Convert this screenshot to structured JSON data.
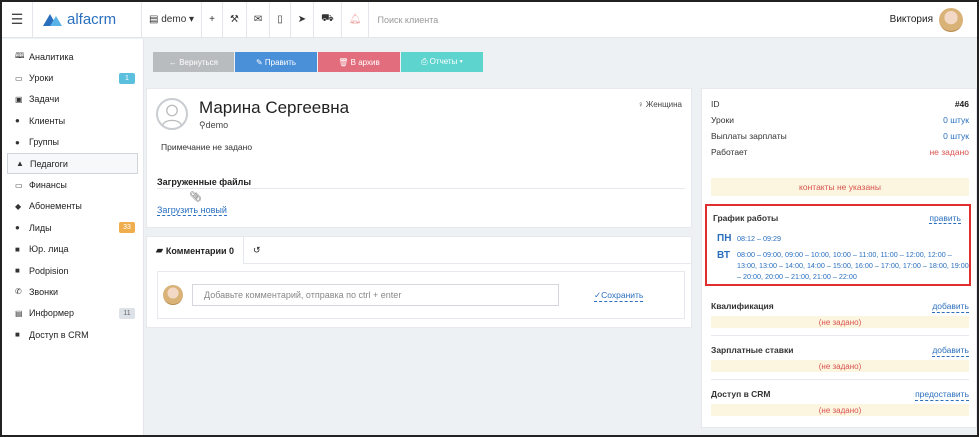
{
  "topbar": {
    "brand": "alfacrm",
    "branch": "demo",
    "search_placeholder": "Поиск клиента",
    "user_name": "Виктория",
    "icons": [
      "menu-icon",
      "branch-icon",
      "plus-icon",
      "wrench-icon",
      "mail-icon",
      "phone-icon",
      "telegram-icon",
      "cart-icon",
      "bell-icon"
    ]
  },
  "sidebar": {
    "items": [
      {
        "label": "Аналитика",
        "icon": "book-icon",
        "glyph": "🕮",
        "badge": null
      },
      {
        "label": "Уроки",
        "icon": "calendar-icon",
        "glyph": "▭",
        "badge": "1",
        "badge_color": "#5bc0de"
      },
      {
        "label": "Задачи",
        "icon": "clipboard-icon",
        "glyph": "▣",
        "badge": null
      },
      {
        "label": "Клиенты",
        "icon": "user-icon",
        "glyph": "●",
        "badge": null
      },
      {
        "label": "Группы",
        "icon": "users-icon",
        "glyph": "●",
        "badge": null
      },
      {
        "label": "Педагоги",
        "icon": "graduation-cap-icon",
        "glyph": "▲",
        "badge": null,
        "active": true
      },
      {
        "label": "Финансы",
        "icon": "money-icon",
        "glyph": "▭",
        "badge": null
      },
      {
        "label": "Абонементы",
        "icon": "tags-icon",
        "glyph": "◆",
        "badge": null
      },
      {
        "label": "Лиды",
        "icon": "user-plus-icon",
        "glyph": "●",
        "badge": "33",
        "badge_color": "#f0ad4e"
      },
      {
        "label": "Юр. лица",
        "icon": "briefcase-icon",
        "glyph": "■",
        "badge": null
      },
      {
        "label": "Podpision",
        "icon": "file-icon",
        "glyph": "■",
        "badge": null
      },
      {
        "label": "Звонки",
        "icon": "phone-icon",
        "glyph": "✆",
        "badge": null
      },
      {
        "label": "Информер",
        "icon": "newspaper-icon",
        "glyph": "▤",
        "badge": "11",
        "badge_color": "#dde2e8"
      },
      {
        "label": "Доступ в CRM",
        "icon": "lock-icon",
        "glyph": "■",
        "badge": null
      }
    ]
  },
  "actions": {
    "back": "← Вернуться",
    "edit": "✎ Править",
    "archive": "🗑 В архив",
    "reports": "⎙ Отчеты ▾"
  },
  "profile": {
    "name": "Марина Сергеевна",
    "location": "demo",
    "gender": "Женщина",
    "note": "Примечание не задано",
    "files_title": "Загруженные файлы",
    "upload_label": "Загрузить новый"
  },
  "comments": {
    "tab_label": "Комментарии 0",
    "placeholder": "Добавьте комментарий, отправка по ctrl + enter",
    "save_label": "Сохранить"
  },
  "info": {
    "id_label": "ID",
    "id_value": "#46",
    "lessons_label": "Уроки",
    "lessons_value": "0 штук",
    "payouts_label": "Выплаты зарплаты",
    "payouts_value": "0 штук",
    "works_label": "Работает",
    "works_value": "не задано",
    "contacts_warning": "контакты не указаны"
  },
  "schedule": {
    "title": "График работы",
    "edit_label": "править",
    "days": [
      {
        "day": "ПН",
        "times": "08:12 – 09:29"
      },
      {
        "day": "ВТ",
        "times": "08:00 – 09:00, 09:00 – 10:00, 10:00 – 11:00, 11:00 – 12:00, 12:00 – 13:00, 13:00 – 14:00, 14:00 – 15:00, 16:00 – 17:00, 17:00 – 18:00, 19:00 – 20:00, 20:00 – 21:00, 21:00 – 22:00"
      }
    ]
  },
  "sections": [
    {
      "title": "Квалификация",
      "action": "добавить",
      "empty": "(не задано)"
    },
    {
      "title": "Зарплатные ставки",
      "action": "добавить",
      "empty": "(не задано)"
    },
    {
      "title": "Доступ в CRM",
      "action": "предоставить",
      "empty": "(не задано)"
    }
  ]
}
